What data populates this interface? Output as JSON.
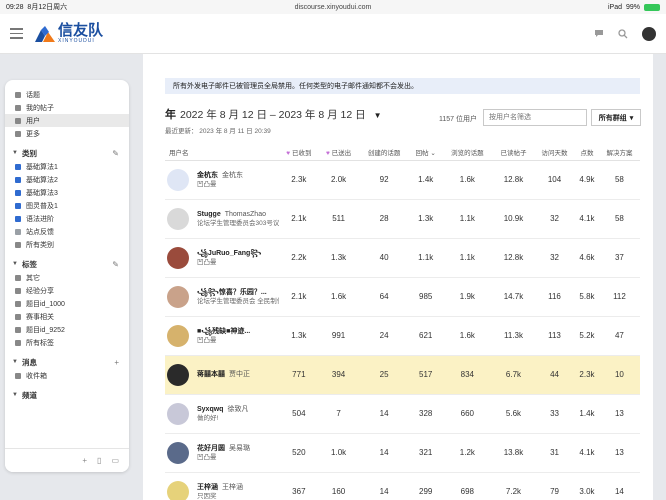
{
  "status_bar": {
    "time": "09:28",
    "date": "8月12日周六",
    "url": "discourse.xinyoudui.com",
    "wifi": "iPad",
    "battery": "99%"
  },
  "header": {
    "logo_text": "信友队",
    "logo_sub": "XINYOUDUI"
  },
  "sidebar": {
    "top_items": [
      {
        "label": "话题",
        "icon": "topics-icon"
      },
      {
        "label": "我的帖子",
        "icon": "my-posts-icon"
      },
      {
        "label": "用户",
        "icon": "users-icon"
      },
      {
        "label": "更多",
        "icon": "more-icon"
      }
    ],
    "sections": [
      {
        "title": "类别",
        "items": [
          "基础算法1",
          "基础算法2",
          "基础算法3",
          "图灵普及1",
          "语法进阶",
          "站点反馈",
          "所有类别"
        ]
      },
      {
        "title": "标签",
        "items": [
          "其它",
          "经验分享",
          "题目id_1000",
          "赛事相关",
          "题目id_9252",
          "所有标签"
        ]
      },
      {
        "title": "消息",
        "items": [
          "收件箱"
        ]
      },
      {
        "title": "频道",
        "items": []
      }
    ]
  },
  "banner": "所有外发电子邮件已被管理员全局禁用。任何类型的电子邮件通知都不会发出。",
  "period": {
    "year_label": "年",
    "range": "2022 年 8 月 12 日 – 2023 年 8 月 12 日"
  },
  "updated": "最近更新：  2023 年 8 月 11 日 20:39",
  "user_count": "1157 位用户",
  "filter_placeholder": "按用户名筛选",
  "groups_button": "所有群组",
  "columns": [
    "用户名",
    "已收到",
    "已送出",
    "创建的话题",
    "回帖",
    "浏览的话题",
    "已读帖子",
    "访问天数",
    "点数",
    "解决方案"
  ],
  "rows": [
    {
      "username": "金杭东",
      "realname": "金杭东",
      "title": "凹凸曼",
      "values": [
        "2.3k",
        "2.0k",
        "92",
        "1.4k",
        "1.6k",
        "12.8k",
        "104",
        "4.9k",
        "58"
      ]
    },
    {
      "username": "Stugge",
      "realname": "ThomasZhao",
      "title": "论坛学生管理委员会303号议员",
      "values": [
        "2.1k",
        "511",
        "28",
        "1.3k",
        "1.1k",
        "10.9k",
        "32",
        "4.1k",
        "58"
      ]
    },
    {
      "username": "꧁JuRuo_Fang꧂",
      "realname": "",
      "title": "凹凸曼",
      "values": [
        "2.2k",
        "1.3k",
        "40",
        "1.1k",
        "1.1k",
        "12.8k",
        "32",
        "4.6k",
        "37"
      ]
    },
    {
      "username": "꧁꧂惊喜？乐园？...",
      "realname": "",
      "title": "论坛学生管理委员会 全民制作人",
      "values": [
        "2.1k",
        "1.6k",
        "64",
        "985",
        "1.9k",
        "14.7k",
        "116",
        "5.8k",
        "112"
      ]
    },
    {
      "username": "■꧁残缺■神迹...",
      "realname": "",
      "title": "凹凸曼",
      "values": [
        "1.3k",
        "991",
        "24",
        "621",
        "1.6k",
        "11.3k",
        "113",
        "5.2k",
        "47"
      ]
    },
    {
      "username": "蒋囍本囍",
      "realname": "贾中正",
      "title": "",
      "values": [
        "771",
        "394",
        "25",
        "517",
        "834",
        "6.7k",
        "44",
        "2.3k",
        "10"
      ]
    },
    {
      "username": "Syxqwq",
      "realname": "徐致凡",
      "title": "做的好!",
      "values": [
        "504",
        "7",
        "14",
        "328",
        "660",
        "5.6k",
        "33",
        "1.4k",
        "13"
      ]
    },
    {
      "username": "花好月圆",
      "realname": "吴易璐",
      "title": "凹凸曼",
      "values": [
        "520",
        "1.0k",
        "14",
        "321",
        "1.2k",
        "13.8k",
        "31",
        "4.1k",
        "13"
      ]
    },
    {
      "username": "王梓涵",
      "realname": "王梓涵",
      "title": "只因奖",
      "values": [
        "367",
        "160",
        "14",
        "299",
        "698",
        "7.2k",
        "79",
        "3.0k",
        "14"
      ]
    }
  ],
  "colors": {
    "brand": "#1b4fa0",
    "highlight_row": "#fbf2c5",
    "banner_bg": "#e8eef9",
    "heart": "#c470d6"
  }
}
